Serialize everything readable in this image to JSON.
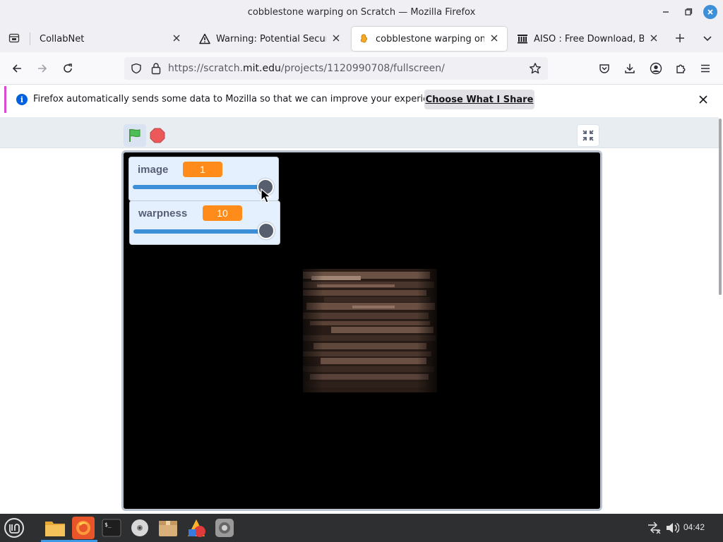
{
  "window": {
    "title": "cobblestone warping on Scratch — Mozilla Firefox"
  },
  "tabs": [
    {
      "label": "CollabNet",
      "icon": "no-icon"
    },
    {
      "label": "Warning: Potential Security",
      "icon": "warning-icon"
    },
    {
      "label": "cobblestone warping on Scr",
      "icon": "scratch-icon",
      "active": true
    },
    {
      "label": "AISO : Free Download, Borr",
      "icon": "archive-icon"
    }
  ],
  "urlbar": {
    "prefix": "https://scratch.",
    "domain": "mit.edu",
    "path": "/projects/1120990708/fullscreen/"
  },
  "notification": {
    "text": "Firefox automatically sends some data to Mozilla so that we can improve your experience.",
    "button_label": "Choose What I Share"
  },
  "monitors": [
    {
      "label": "image",
      "value": "1",
      "slider_fraction": 1.0
    },
    {
      "label": "warpness",
      "value": "10",
      "slider_fraction": 1.0
    }
  ],
  "taskbar": {
    "clock": "04:42"
  },
  "colors": {
    "accent": "#3d8fd8",
    "monitor_value": "#ff8c1a",
    "notification_bar": "#d84ad0"
  }
}
